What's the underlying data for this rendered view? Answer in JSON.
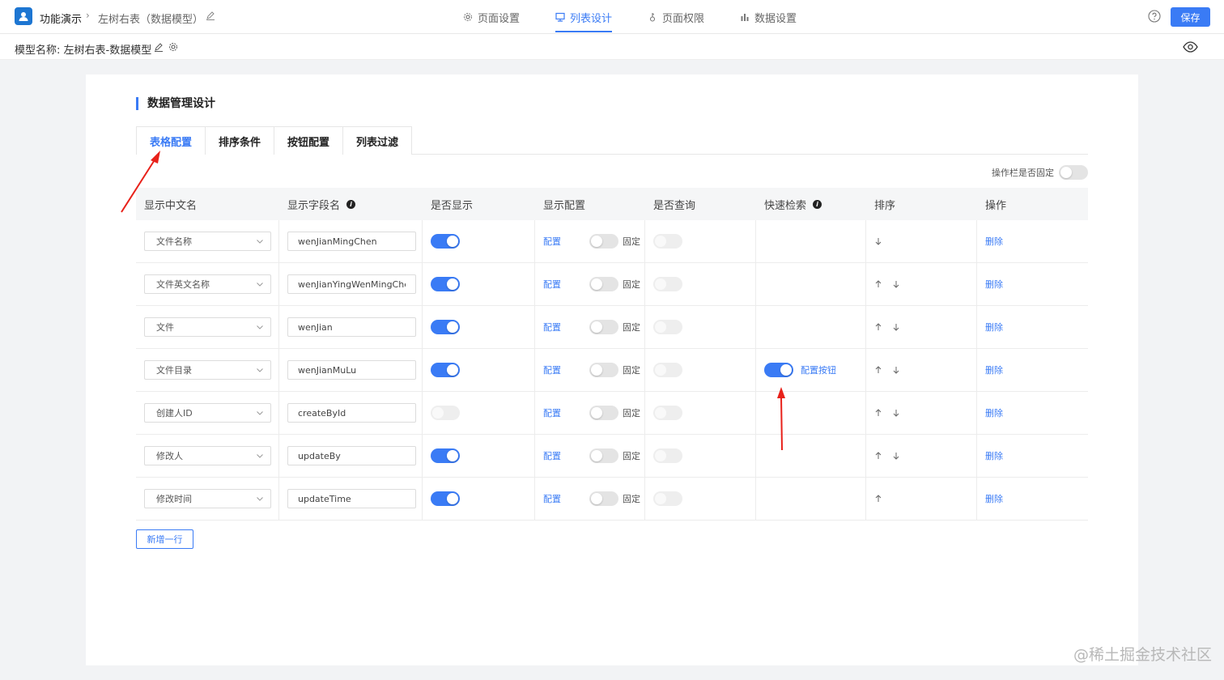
{
  "header": {
    "app_name": "功能演示",
    "page_name": "左树右表（数据模型）",
    "tabs": [
      {
        "label": "页面设置",
        "icon": "gear-icon",
        "active": false
      },
      {
        "label": "列表设计",
        "icon": "list-design-icon",
        "active": true
      },
      {
        "label": "页面权限",
        "icon": "key-icon",
        "active": false
      },
      {
        "label": "数据设置",
        "icon": "bar-chart-icon",
        "active": false
      }
    ],
    "save_label": "保存"
  },
  "model": {
    "label": "模型名称:  左树右表-数据模型"
  },
  "card": {
    "title": "数据管理设计",
    "sub_tabs": [
      "表格配置",
      "排序条件",
      "按钮配置",
      "列表过滤"
    ],
    "active_sub_tab": 0,
    "fixed_op_label": "操作栏是否固定",
    "fixed_op_on": false,
    "columns": [
      "显示中文名",
      "显示字段名",
      "是否显示",
      "显示配置",
      "是否查询",
      "快速检索",
      "排序",
      "操作"
    ],
    "config_label": "配置",
    "fixed_label": "固定",
    "delete_label": "删除",
    "quick_config_label": "配置按钮",
    "rows": [
      {
        "cn_name": "文件名称",
        "field": "wenJianMingChen",
        "show": true,
        "fixed": false,
        "query": false,
        "quick": false,
        "sort": [
          "down"
        ]
      },
      {
        "cn_name": "文件英文名称",
        "field": "wenJianYingWenMingChe",
        "show": true,
        "fixed": false,
        "query": false,
        "quick": false,
        "sort": [
          "up",
          "down"
        ]
      },
      {
        "cn_name": "文件",
        "field": "wenJian",
        "show": true,
        "fixed": false,
        "query": false,
        "quick": false,
        "sort": [
          "up",
          "down"
        ]
      },
      {
        "cn_name": "文件目录",
        "field": "wenJianMuLu",
        "show": true,
        "fixed": false,
        "query": false,
        "quick": true,
        "sort": [
          "up",
          "down"
        ]
      },
      {
        "cn_name": "创建人ID",
        "field": "createById",
        "show": false,
        "fixed": false,
        "query": false,
        "quick": false,
        "sort": [
          "up",
          "down"
        ]
      },
      {
        "cn_name": "修改人",
        "field": "updateBy",
        "show": true,
        "fixed": false,
        "query": false,
        "quick": false,
        "sort": [
          "up",
          "down"
        ]
      },
      {
        "cn_name": "修改时间",
        "field": "updateTime",
        "show": true,
        "fixed": false,
        "query": false,
        "quick": false,
        "sort": [
          "up"
        ]
      }
    ],
    "add_row_label": "新增一行"
  },
  "watermark": "@稀土掘金技术社区",
  "colors": {
    "accent": "#3a7bf5",
    "annotation": "#e8211a"
  }
}
